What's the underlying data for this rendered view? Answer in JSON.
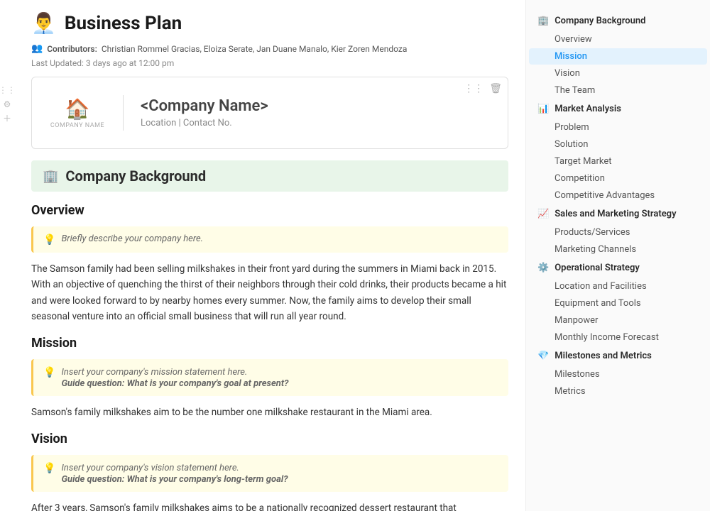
{
  "page": {
    "title": "Business Plan",
    "title_icon": "👨‍💼",
    "meta": {
      "contributors_label": "Contributors:",
      "contributors": "Christian Rommel Gracias, Eloiza Serate, Jan Duane Manalo, Kier Zoren Mendoza",
      "last_updated_label": "Last Updated:",
      "last_updated": "3 days ago at 12:00 pm",
      "contributors_icon": "👥"
    },
    "company_card": {
      "logo_icon": "🏠",
      "logo_subtext": "COMPANY NAME",
      "company_name": "<Company Name>",
      "location": "Location | Contact No."
    }
  },
  "content": {
    "section_header": {
      "icon": "🏢",
      "title": "Company Background"
    },
    "overview": {
      "title": "Overview",
      "hint": "Briefly describe your company here.",
      "body": "The Samson family had been selling milkshakes in their front yard during the summers in Miami back in 2015. With an objective of quenching the thirst of their neighbors through their cold drinks, their products became a hit and were looked forward to by nearby homes every summer. Now, the family aims to develop their small seasonal venture into an official small business that will run all year round."
    },
    "mission": {
      "title": "Mission",
      "hint_line1": "Insert your company's mission statement here.",
      "hint_line2": "Guide question: What is your company's goal at present?",
      "body": "Samson's family milkshakes aim to be the number one milkshake restaurant in the Miami area."
    },
    "vision": {
      "title": "Vision",
      "hint_line1": "Insert your company's vision statement here.",
      "hint_line2": "Guide question: What is your company's long-term goal?",
      "body": "After 3 years, Samson's family milkshakes aims to be a nationally recognized dessert restaurant that"
    }
  },
  "sidebar": {
    "sections": [
      {
        "id": "company-background",
        "icon": "🏢",
        "label": "Company Background",
        "items": [
          {
            "id": "overview",
            "label": "Overview",
            "active": false
          },
          {
            "id": "mission",
            "label": "Mission",
            "active": true
          },
          {
            "id": "vision",
            "label": "Vision",
            "active": false
          },
          {
            "id": "the-team",
            "label": "The Team",
            "active": false
          }
        ]
      },
      {
        "id": "market-analysis",
        "icon": "📊",
        "label": "Market Analysis",
        "items": [
          {
            "id": "problem",
            "label": "Problem",
            "active": false
          },
          {
            "id": "solution",
            "label": "Solution",
            "active": false
          },
          {
            "id": "target-market",
            "label": "Target Market",
            "active": false
          },
          {
            "id": "competition",
            "label": "Competition",
            "active": false
          },
          {
            "id": "competitive-advantages",
            "label": "Competitive Advantages",
            "active": false
          }
        ]
      },
      {
        "id": "sales-marketing",
        "icon": "📈",
        "label": "Sales and Marketing Strategy",
        "items": [
          {
            "id": "products-services",
            "label": "Products/Services",
            "active": false
          },
          {
            "id": "marketing-channels",
            "label": "Marketing Channels",
            "active": false
          }
        ]
      },
      {
        "id": "operational-strategy",
        "icon": "⚙️",
        "label": "Operational Strategy",
        "items": [
          {
            "id": "location-facilities",
            "label": "Location and Facilities",
            "active": false
          },
          {
            "id": "equipment-tools",
            "label": "Equipment and Tools",
            "active": false
          },
          {
            "id": "manpower",
            "label": "Manpower",
            "active": false
          },
          {
            "id": "monthly-income",
            "label": "Monthly Income Forecast",
            "active": false
          }
        ]
      },
      {
        "id": "milestones-metrics",
        "icon": "💎",
        "label": "Milestones and Metrics",
        "items": [
          {
            "id": "milestones",
            "label": "Milestones",
            "active": false
          },
          {
            "id": "metrics",
            "label": "Metrics",
            "active": false
          }
        ]
      }
    ]
  }
}
